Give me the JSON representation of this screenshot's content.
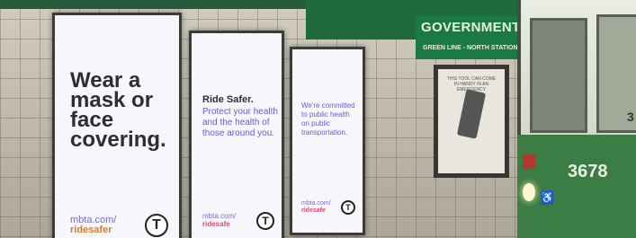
{
  "station_sign": {
    "name": "GOVERNMENT CENT",
    "line": "GREEN LINE - NORTH STATION"
  },
  "posters": [
    {
      "headline": "Wear a mask or face covering.",
      "url_prefix": "mbta.com/",
      "url_highlight": "ridesafer",
      "logo": "T"
    },
    {
      "title": "Ride Safer.",
      "body": "Protect your health and the health of those around you.",
      "url_prefix": "mbta.com/",
      "url_highlight": "ridesafe",
      "logo": "T"
    },
    {
      "body": "We're committed to public health on public transportation.",
      "url_prefix": "mbta.com/",
      "url_highlight": "ridesafe",
      "logo": "T"
    }
  ],
  "notice_board": {
    "text": "This tool can come in handy in an emergency"
  },
  "train": {
    "number": "3678",
    "side_number": "3"
  },
  "colors": {
    "accent_purple": "#6a58d8",
    "brand_pink": "#e0457a",
    "station_green": "#1b7a44"
  }
}
